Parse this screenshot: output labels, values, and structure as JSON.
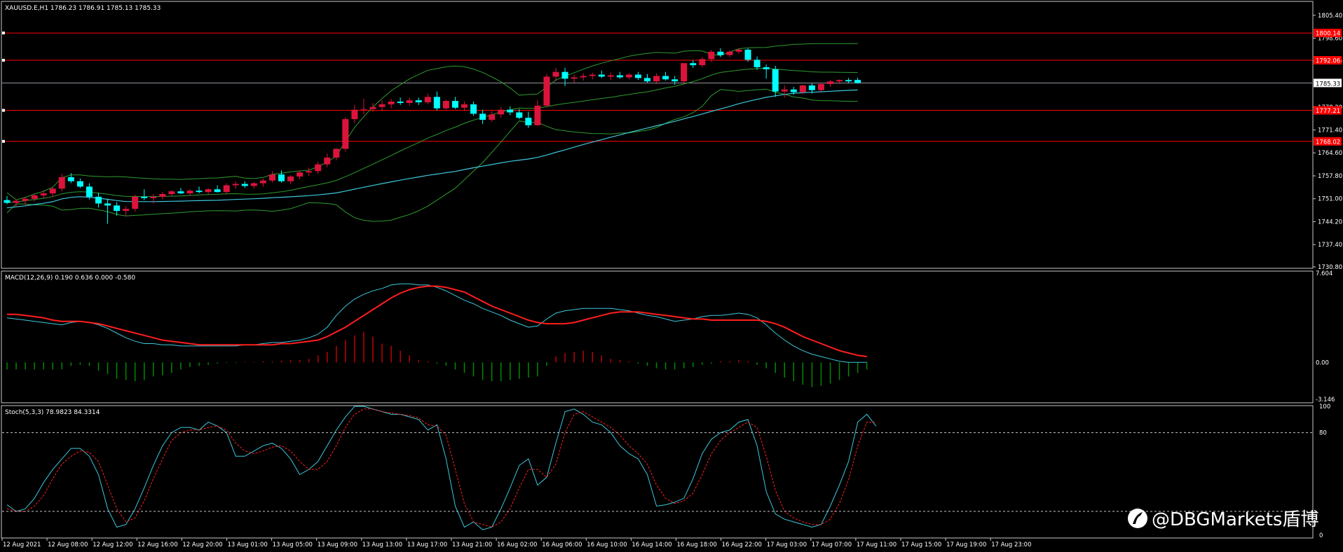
{
  "colors": {
    "background": "#000000",
    "frame": "#c8c8c8",
    "text": "#ffffff",
    "bull": "#dc143c",
    "bear": "#00ffff",
    "level_line": "#ff0000",
    "bollinger": "#2e9b2e",
    "moving_average": "#3cc8dc",
    "macd_signal": "#ff1e1e",
    "hist_pos": "#c00000",
    "hist_neg": "#008a00",
    "stoch_signal": "#ff2020",
    "watermark": "#ffffff"
  },
  "main_panel": {
    "header": "XAUUSD.E,H1  1786.23 1786.91 1785.13 1785.33",
    "price_scale": [
      "1805.40",
      "1798.60",
      "1791.80",
      "1785.33",
      "1778.20",
      "1771.40",
      "1764.60",
      "1757.80",
      "1751.00",
      "1744.20",
      "1737.40",
      "1730.80"
    ],
    "level_labels": [
      "1800.14",
      "1792.06",
      "1777.21",
      "1768.02"
    ],
    "current_price": "1785.33"
  },
  "macd_panel": {
    "header": "MACD(12,26,9) 0.190 0.636 0.000 -0.580",
    "scale": [
      "7.604",
      "0.00",
      "-3.146"
    ]
  },
  "stoch_panel": {
    "header": "Stoch(5,3,3) 78.9823 84.3314",
    "scale": [
      "100",
      "80",
      "0"
    ]
  },
  "time_axis": [
    "12 Aug 2021",
    "12 Aug 08:00",
    "12 Aug 12:00",
    "12 Aug 16:00",
    "12 Aug 20:00",
    "13 Aug 01:00",
    "13 Aug 05:00",
    "13 Aug 09:00",
    "13 Aug 13:00",
    "13 Aug 17:00",
    "13 Aug 21:00",
    "16 Aug 02:00",
    "16 Aug 06:00",
    "16 Aug 10:00",
    "16 Aug 14:00",
    "16 Aug 18:00",
    "16 Aug 22:00",
    "17 Aug 03:00",
    "17 Aug 07:00",
    "17 Aug 11:00",
    "17 Aug 15:00",
    "17 Aug 19:00",
    "17 Aug 23:00"
  ],
  "watermark": "@DBGMarkets盾博",
  "chart_data": {
    "type": "candlestick",
    "symbol": "XAUUSD.E",
    "timeframe": "H1",
    "ohlc": [
      [
        1750.6,
        1751.8,
        1749.4,
        1749.8
      ],
      [
        1749.8,
        1750.8,
        1748.6,
        1750.4
      ],
      [
        1750.4,
        1751.6,
        1749.2,
        1751.0
      ],
      [
        1751.0,
        1752.4,
        1750.2,
        1752.0
      ],
      [
        1752.0,
        1753.6,
        1751.2,
        1752.6
      ],
      [
        1752.6,
        1754.4,
        1751.6,
        1754.0
      ],
      [
        1754.0,
        1758.4,
        1753.2,
        1757.4
      ],
      [
        1757.4,
        1758.6,
        1755.6,
        1756.2
      ],
      [
        1756.2,
        1757.0,
        1754.2,
        1754.6
      ],
      [
        1754.6,
        1755.6,
        1750.8,
        1751.6
      ],
      [
        1751.6,
        1752.8,
        1748.4,
        1749.6
      ],
      [
        1749.6,
        1751.0,
        1743.6,
        1749.0
      ],
      [
        1749.0,
        1750.0,
        1746.0,
        1747.4
      ],
      [
        1747.4,
        1748.8,
        1746.0,
        1748.0
      ],
      [
        1748.0,
        1752.2,
        1747.2,
        1751.6
      ],
      [
        1751.6,
        1753.8,
        1750.6,
        1751.2
      ],
      [
        1751.2,
        1752.4,
        1749.6,
        1751.6
      ],
      [
        1751.6,
        1753.0,
        1750.8,
        1752.4
      ],
      [
        1752.4,
        1753.6,
        1751.6,
        1753.2
      ],
      [
        1753.2,
        1754.2,
        1752.4,
        1752.6
      ],
      [
        1752.6,
        1753.8,
        1751.8,
        1753.4
      ],
      [
        1753.4,
        1754.6,
        1752.6,
        1753.0
      ],
      [
        1753.0,
        1754.2,
        1752.2,
        1753.8
      ],
      [
        1753.8,
        1755.0,
        1752.8,
        1753.0
      ],
      [
        1753.0,
        1755.6,
        1752.4,
        1755.0
      ],
      [
        1755.0,
        1756.2,
        1754.0,
        1755.4
      ],
      [
        1755.4,
        1756.2,
        1754.2,
        1754.8
      ],
      [
        1754.8,
        1756.0,
        1754.0,
        1755.6
      ],
      [
        1755.6,
        1757.0,
        1754.6,
        1756.4
      ],
      [
        1756.4,
        1759.2,
        1755.8,
        1758.2
      ],
      [
        1758.2,
        1759.4,
        1755.8,
        1756.2
      ],
      [
        1756.2,
        1758.0,
        1755.4,
        1757.6
      ],
      [
        1757.6,
        1759.4,
        1756.8,
        1758.8
      ],
      [
        1758.8,
        1760.2,
        1757.8,
        1759.2
      ],
      [
        1759.2,
        1762.0,
        1758.4,
        1761.2
      ],
      [
        1761.2,
        1764.4,
        1760.4,
        1763.2
      ],
      [
        1763.2,
        1766.0,
        1762.4,
        1765.8
      ],
      [
        1765.8,
        1775.2,
        1765.0,
        1774.6
      ],
      [
        1774.6,
        1778.8,
        1773.4,
        1777.4
      ],
      [
        1777.4,
        1780.6,
        1776.0,
        1777.6
      ],
      [
        1777.6,
        1779.4,
        1776.8,
        1778.2
      ],
      [
        1778.2,
        1780.2,
        1777.0,
        1779.0
      ],
      [
        1779.0,
        1780.6,
        1777.8,
        1779.8
      ],
      [
        1779.8,
        1781.0,
        1778.8,
        1779.4
      ],
      [
        1779.4,
        1781.0,
        1778.6,
        1780.2
      ],
      [
        1780.2,
        1781.0,
        1778.8,
        1779.6
      ],
      [
        1779.6,
        1782.2,
        1779.0,
        1781.2
      ],
      [
        1781.2,
        1782.8,
        1777.2,
        1777.8
      ],
      [
        1777.8,
        1780.4,
        1777.4,
        1780.0
      ],
      [
        1780.0,
        1781.2,
        1777.6,
        1778.0
      ],
      [
        1778.0,
        1779.8,
        1777.0,
        1779.0
      ],
      [
        1779.0,
        1779.8,
        1775.6,
        1776.2
      ],
      [
        1776.2,
        1777.4,
        1773.2,
        1774.4
      ],
      [
        1774.4,
        1777.0,
        1773.8,
        1776.0
      ],
      [
        1776.0,
        1778.2,
        1775.0,
        1777.4
      ],
      [
        1777.4,
        1778.4,
        1775.8,
        1776.6
      ],
      [
        1776.6,
        1777.6,
        1774.6,
        1775.0
      ],
      [
        1775.0,
        1776.8,
        1772.0,
        1772.8
      ],
      [
        1772.8,
        1780.2,
        1772.6,
        1778.6
      ],
      [
        1778.6,
        1788.0,
        1778.2,
        1787.2
      ],
      [
        1787.2,
        1789.8,
        1785.8,
        1788.6
      ],
      [
        1788.6,
        1789.8,
        1784.4,
        1786.6
      ],
      [
        1786.6,
        1787.8,
        1785.4,
        1787.0
      ],
      [
        1787.0,
        1788.2,
        1786.0,
        1787.4
      ],
      [
        1787.4,
        1788.4,
        1786.4,
        1787.8
      ],
      [
        1787.8,
        1789.0,
        1786.8,
        1787.2
      ],
      [
        1787.2,
        1788.4,
        1786.2,
        1787.6
      ],
      [
        1787.6,
        1788.6,
        1786.6,
        1787.0
      ],
      [
        1787.0,
        1788.2,
        1786.4,
        1787.8
      ],
      [
        1787.8,
        1788.6,
        1786.2,
        1786.8
      ],
      [
        1786.8,
        1788.0,
        1785.4,
        1785.8
      ],
      [
        1785.8,
        1788.2,
        1785.0,
        1787.4
      ],
      [
        1787.4,
        1788.6,
        1786.0,
        1786.4
      ],
      [
        1786.4,
        1787.4,
        1784.8,
        1785.8
      ],
      [
        1785.8,
        1790.2,
        1785.0,
        1791.2
      ],
      [
        1791.2,
        1792.0,
        1789.8,
        1790.6
      ],
      [
        1790.6,
        1793.0,
        1790.0,
        1792.4
      ],
      [
        1792.4,
        1795.2,
        1791.6,
        1794.6
      ],
      [
        1794.6,
        1795.6,
        1793.0,
        1793.6
      ],
      [
        1793.6,
        1795.0,
        1793.0,
        1794.6
      ],
      [
        1794.6,
        1795.6,
        1794.0,
        1795.2
      ],
      [
        1795.2,
        1795.6,
        1791.6,
        1792.2
      ],
      [
        1792.2,
        1793.2,
        1789.2,
        1790.0
      ],
      [
        1790.0,
        1790.8,
        1786.6,
        1789.4
      ],
      [
        1789.4,
        1790.4,
        1781.2,
        1782.8
      ],
      [
        1782.8,
        1784.6,
        1781.0,
        1783.4
      ],
      [
        1783.4,
        1784.2,
        1781.8,
        1782.6
      ],
      [
        1782.6,
        1784.8,
        1782.0,
        1784.6
      ],
      [
        1784.6,
        1785.2,
        1782.2,
        1783.2
      ],
      [
        1783.2,
        1785.4,
        1782.8,
        1785.0
      ],
      [
        1785.0,
        1786.2,
        1784.2,
        1785.8
      ],
      [
        1785.8,
        1786.4,
        1785.0,
        1786.2
      ],
      [
        1786.2,
        1786.8,
        1785.2,
        1785.8
      ],
      [
        1786.23,
        1786.91,
        1785.13,
        1785.33
      ]
    ],
    "horizontal_levels": [
      1800.14,
      1792.06,
      1777.21,
      1768.02
    ],
    "price_range": [
      1730.8,
      1806.6
    ],
    "macd": {
      "params": "12,26,9",
      "range": [
        -3.146,
        7.604
      ],
      "main": [
        3.8,
        3.7,
        3.6,
        3.5,
        3.4,
        3.3,
        3.2,
        3.4,
        3.5,
        3.4,
        3.2,
        2.9,
        2.5,
        2.1,
        1.8,
        1.6,
        1.6,
        1.5,
        1.5,
        1.4,
        1.4,
        1.4,
        1.4,
        1.4,
        1.4,
        1.4,
        1.5,
        1.5,
        1.6,
        1.7,
        1.7,
        1.8,
        1.9,
        2.1,
        2.4,
        3.0,
        4.0,
        4.8,
        5.4,
        5.8,
        6.1,
        6.3,
        6.6,
        6.7,
        6.7,
        6.6,
        6.6,
        6.4,
        6.1,
        5.7,
        5.3,
        5.0,
        4.6,
        4.3,
        4.0,
        3.6,
        3.3,
        3.0,
        3.1,
        3.7,
        4.2,
        4.4,
        4.5,
        4.6,
        4.6,
        4.6,
        4.6,
        4.5,
        4.4,
        4.2,
        4.0,
        3.9,
        3.7,
        3.5,
        3.6,
        3.7,
        3.9,
        4.0,
        4.0,
        4.1,
        4.2,
        4.1,
        3.8,
        3.2,
        2.5,
        1.9,
        1.4,
        1.0,
        0.7,
        0.5,
        0.3,
        0.1,
        0.0,
        0.0,
        0.0
      ],
      "signal": [
        4.1,
        4.1,
        4.0,
        3.9,
        3.8,
        3.6,
        3.5,
        3.5,
        3.5,
        3.4,
        3.3,
        3.1,
        2.9,
        2.7,
        2.5,
        2.3,
        2.1,
        1.9,
        1.8,
        1.7,
        1.6,
        1.5,
        1.5,
        1.5,
        1.5,
        1.5,
        1.5,
        1.5,
        1.5,
        1.5,
        1.6,
        1.6,
        1.7,
        1.8,
        1.9,
        2.2,
        2.6,
        3.0,
        3.5,
        4.0,
        4.5,
        5.0,
        5.5,
        5.9,
        6.2,
        6.4,
        6.5,
        6.5,
        6.4,
        6.2,
        6.0,
        5.6,
        5.2,
        4.8,
        4.5,
        4.2,
        3.9,
        3.6,
        3.4,
        3.3,
        3.3,
        3.3,
        3.4,
        3.6,
        3.8,
        4.0,
        4.2,
        4.3,
        4.3,
        4.3,
        4.2,
        4.1,
        4.0,
        3.9,
        3.8,
        3.7,
        3.7,
        3.6,
        3.6,
        3.6,
        3.6,
        3.6,
        3.6,
        3.5,
        3.3,
        3.0,
        2.6,
        2.2,
        1.9,
        1.6,
        1.3,
        1.0,
        0.8,
        0.6,
        0.5
      ],
      "histogram": [
        -0.6,
        -0.6,
        -0.6,
        -0.6,
        -0.6,
        -0.6,
        -0.6,
        -0.3,
        -0.2,
        -0.3,
        -0.7,
        -1.0,
        -1.4,
        -1.5,
        -1.6,
        -1.5,
        -1.2,
        -1.1,
        -0.9,
        -0.6,
        -0.4,
        -0.3,
        -0.2,
        -0.1,
        -0.05,
        -0.05,
        0.05,
        0.05,
        0.1,
        0.1,
        0.15,
        0.2,
        0.2,
        0.3,
        0.6,
        0.9,
        1.4,
        1.9,
        2.3,
        2.6,
        2.2,
        1.6,
        1.4,
        1.0,
        0.6,
        0.2,
        0.1,
        -0.1,
        -0.3,
        -0.6,
        -0.9,
        -1.2,
        -1.5,
        -1.6,
        -1.6,
        -1.5,
        -1.4,
        -1.3,
        -1.2,
        -0.3,
        0.5,
        0.8,
        0.9,
        1.0,
        0.9,
        0.6,
        0.3,
        0.2,
        0.1,
        -0.1,
        -0.3,
        -0.5,
        -0.6,
        -0.6,
        -0.5,
        -0.4,
        -0.2,
        -0.1,
        0.1,
        0.1,
        0.2,
        0.1,
        -0.2,
        -0.5,
        -0.9,
        -1.3,
        -1.6,
        -1.9,
        -2.1,
        -2.0,
        -1.8,
        -1.5,
        -1.2,
        -0.9,
        -0.6
      ]
    },
    "stochastic": {
      "params": "5,3,3",
      "range": [
        0,
        100
      ],
      "levels": [
        80,
        20
      ],
      "main": [
        25,
        20,
        22,
        30,
        42,
        52,
        60,
        68,
        68,
        62,
        48,
        22,
        8,
        10,
        22,
        38,
        55,
        70,
        80,
        84,
        84,
        82,
        88,
        85,
        80,
        62,
        62,
        66,
        70,
        72,
        68,
        60,
        48,
        52,
        58,
        70,
        82,
        92,
        100,
        100,
        98,
        96,
        94,
        94,
        92,
        90,
        82,
        86,
        60,
        24,
        8,
        12,
        6,
        8,
        22,
        38,
        55,
        60,
        40,
        46,
        72,
        96,
        98,
        94,
        88,
        86,
        80,
        70,
        64,
        60,
        48,
        24,
        25,
        27,
        30,
        45,
        64,
        75,
        80,
        82,
        88,
        90,
        70,
        35,
        18,
        14,
        12,
        10,
        8,
        10,
        24,
        40,
        58,
        88,
        94,
        85
      ],
      "signal": [
        22,
        20,
        20,
        24,
        32,
        45,
        56,
        62,
        66,
        65,
        58,
        40,
        22,
        12,
        15,
        28,
        45,
        60,
        74,
        80,
        82,
        82,
        84,
        85,
        82,
        72,
        66,
        64,
        66,
        69,
        70,
        66,
        58,
        52,
        52,
        58,
        70,
        84,
        94,
        98,
        98,
        96,
        95,
        94,
        93,
        91,
        86,
        85,
        78,
        52,
        26,
        12,
        10,
        8,
        12,
        22,
        38,
        52,
        52,
        46,
        56,
        80,
        94,
        96,
        92,
        88,
        84,
        78,
        70,
        64,
        56,
        40,
        30,
        26,
        28,
        34,
        48,
        64,
        74,
        80,
        84,
        88,
        84,
        62,
        36,
        20,
        15,
        12,
        10,
        10,
        14,
        26,
        44,
        70,
        88,
        88
      ]
    }
  }
}
